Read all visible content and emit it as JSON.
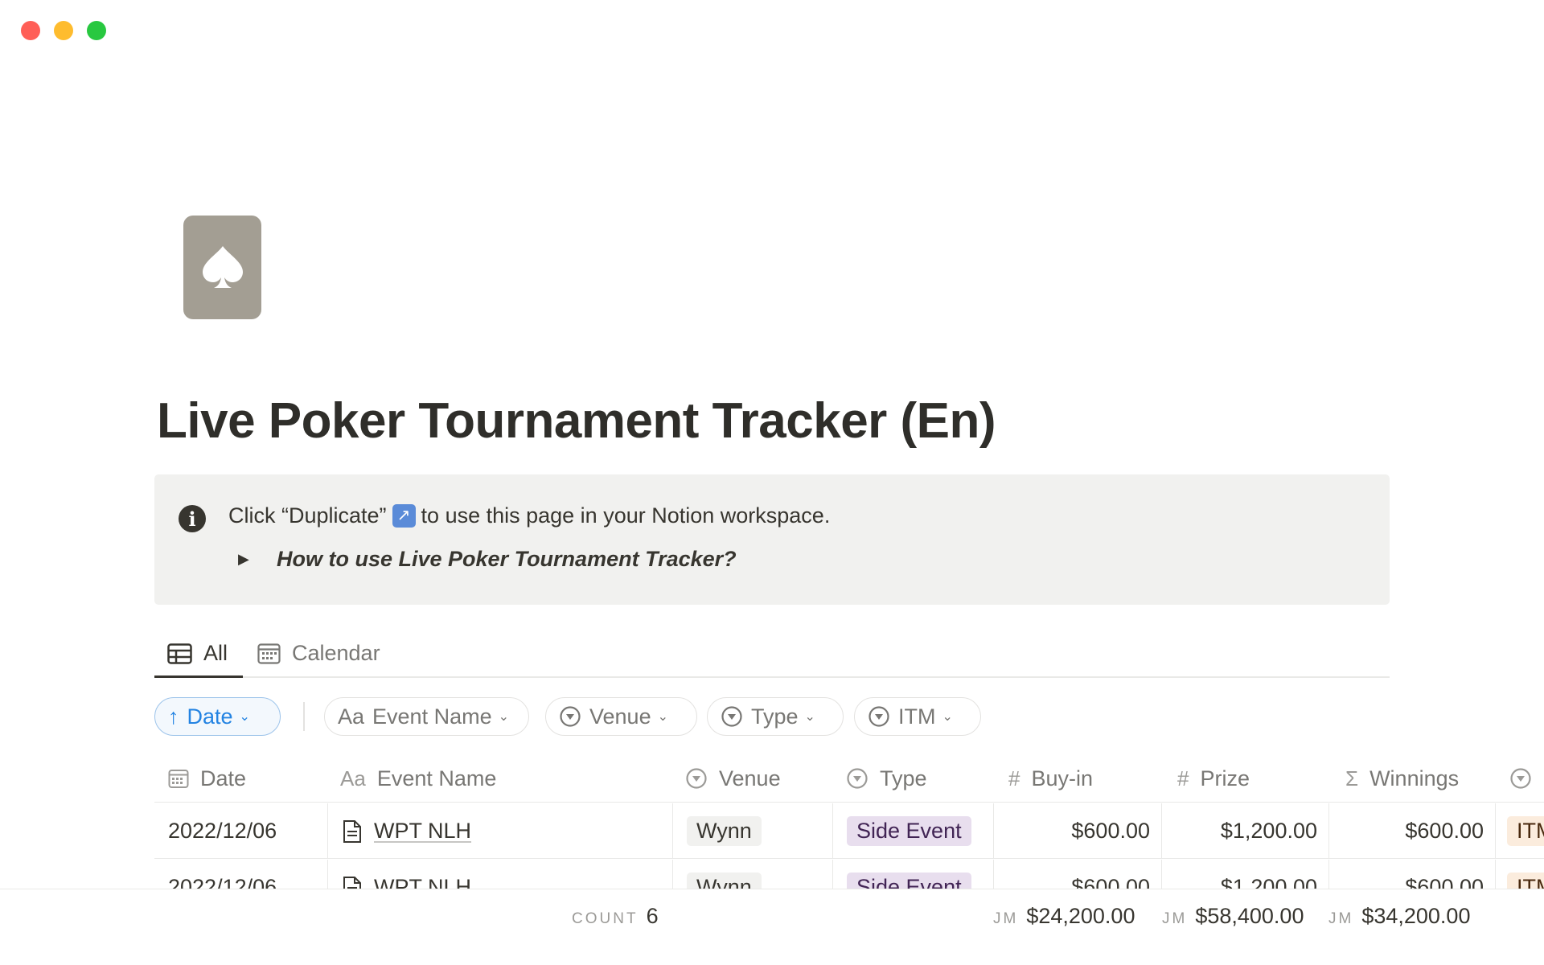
{
  "window": {
    "controls": [
      "close",
      "minimize",
      "zoom"
    ]
  },
  "page": {
    "icon": "spade-icon",
    "title": "Live Poker Tournament Tracker (En)"
  },
  "callout": {
    "icon": "info-icon",
    "text_before": "Click “Duplicate”",
    "duplicate_icon": "arrow-up-right-icon",
    "text_after": "to use this page in your Notion workspace.",
    "toggle_label": "How to use Live Poker Tournament Tracker?"
  },
  "tabs": [
    {
      "label": "All",
      "icon": "table-icon",
      "active": true
    },
    {
      "label": "Calendar",
      "icon": "calendar-icon",
      "active": false
    }
  ],
  "sorts": {
    "date": "Date",
    "event_name": "Event Name",
    "venue": "Venue",
    "type": "Type",
    "itm": "ITM"
  },
  "table": {
    "columns": {
      "date": "Date",
      "event_name": "Event Name",
      "venue": "Venue",
      "type": "Type",
      "buyin": "Buy-in",
      "prize": "Prize",
      "winnings": "Winnings"
    },
    "rows": [
      {
        "date": "2022/12/06",
        "event_name": "WPT NLH",
        "venue": "Wynn",
        "type": "Side Event",
        "buyin": "$600.00",
        "prize": "$1,200.00",
        "winnings": "$600.00",
        "itm": "ITM"
      },
      {
        "date": "2022/12/06",
        "event_name": "WPT NLH",
        "venue": "Wynn",
        "type": "Side Event",
        "buyin": "$600.00",
        "prize": "$1,200.00",
        "winnings": "$600.00",
        "itm": "ITM"
      }
    ]
  },
  "footer": {
    "count_label": "COUNT",
    "count_value": "6",
    "sum_label": "JM",
    "buyin_total": "$24,200.00",
    "prize_total": "$58,400.00",
    "winnings_total": "$34,200.00"
  },
  "colors": {
    "accent_blue": "#2383e2",
    "page_icon_bg": "#a39e93",
    "callout_bg": "#f1f1ef",
    "type_tag_bg": "#e8deee",
    "itm_tag_bg": "#fbecdd"
  }
}
